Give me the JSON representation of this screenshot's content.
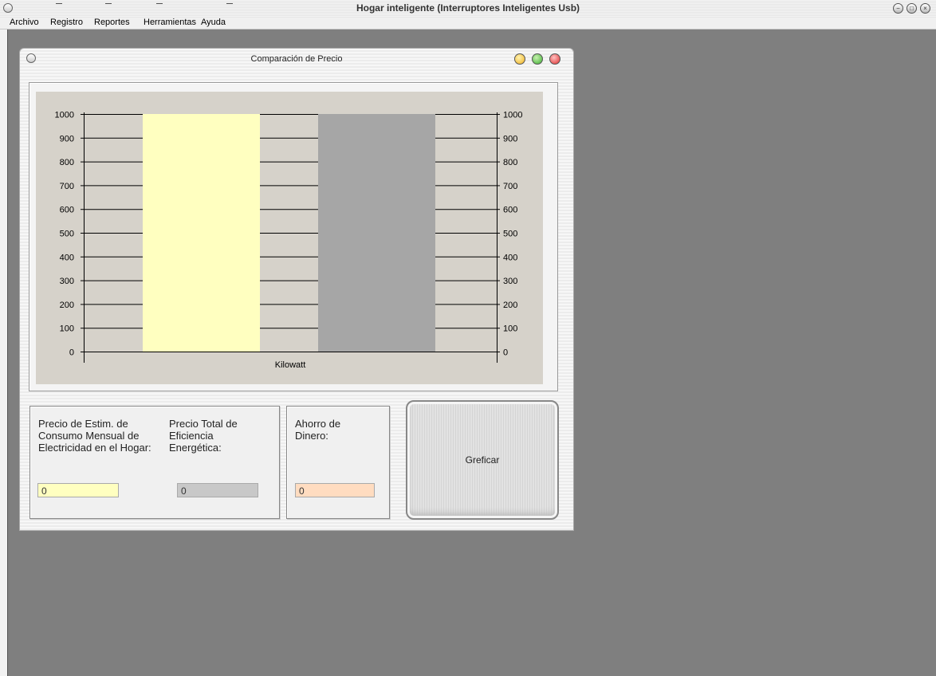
{
  "app": {
    "title": "Hogar inteligente (Interruptores Inteligentes Usb)",
    "window_buttons": [
      "−",
      "□",
      "×"
    ]
  },
  "menu": [
    "Archivo",
    "Registro",
    "Reportes",
    "Herramientas",
    "Ayuda"
  ],
  "child_window": {
    "title": "Comparación de  Precio",
    "lights": [
      "#f0b020",
      "#3cb030",
      "#e03030"
    ]
  },
  "chart_data": {
    "type": "bar",
    "title": "",
    "xlabel": "Kilowatt",
    "ylabel": "",
    "ylim": [
      0,
      1000
    ],
    "y_ticks": [
      0,
      100,
      200,
      300,
      400,
      500,
      600,
      700,
      800,
      900,
      1000
    ],
    "y_tick_labels": [
      "0",
      "100",
      "200",
      "300",
      "400",
      "500",
      "600",
      "700",
      "800",
      "900",
      "1000"
    ],
    "secondary_axis": "right",
    "grid": true,
    "series": [
      {
        "values": [
          1000
        ],
        "color": "#ffffc0"
      },
      {
        "values": [
          1000
        ],
        "color": "#a6a6a6"
      }
    ]
  },
  "panel_left": {
    "label1": "Precio de Estim. de Consumo Mensual de Electricidad en el Hogar:",
    "value1": "0",
    "label2": "Precio Total de Eficiencia Energética:",
    "value2": "0"
  },
  "panel_mid": {
    "label": "Ahorro de Dinero:",
    "value": "0"
  },
  "graph_button": "Greficar",
  "colors": {
    "field_yellow": "#ffffc0",
    "field_gray": "#c8c8c8",
    "field_peach": "#ffdcc0"
  }
}
